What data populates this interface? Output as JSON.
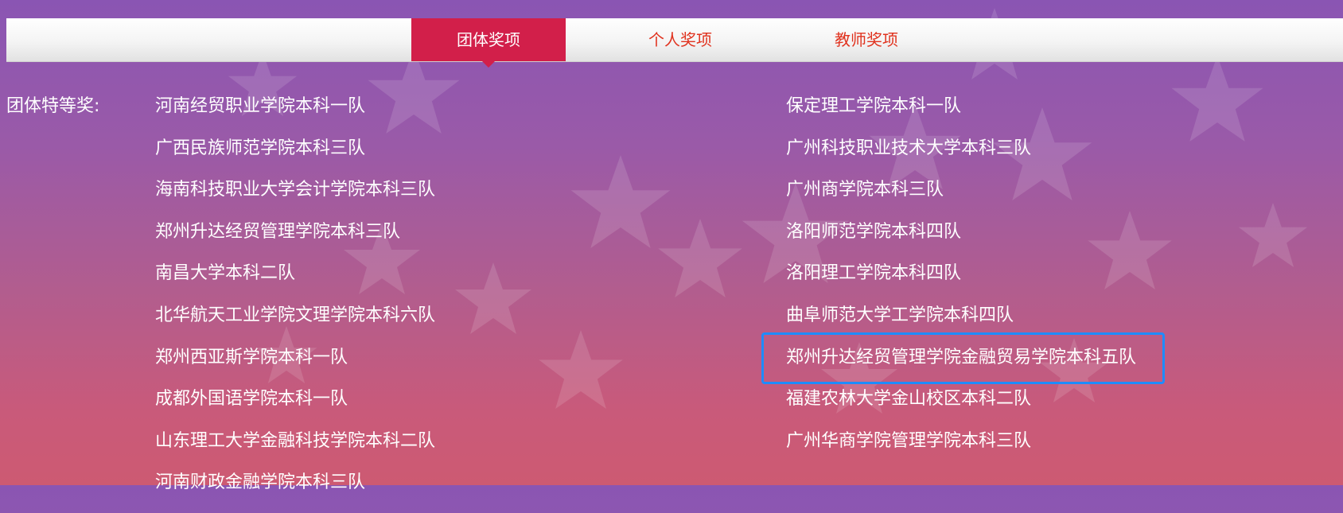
{
  "tabs": [
    {
      "label": "团体奖项",
      "active": true
    },
    {
      "label": "个人奖项",
      "active": false
    },
    {
      "label": "教师奖项",
      "active": false
    }
  ],
  "award_label": "团体特等奖:",
  "left_column": [
    "河南经贸职业学院本科一队",
    "广西民族师范学院本科三队",
    "海南科技职业大学会计学院本科三队",
    "郑州升达经贸管理学院本科三队",
    "南昌大学本科二队",
    "北华航天工业学院文理学院本科六队",
    "郑州西亚斯学院本科一队",
    "成都外国语学院本科一队",
    "山东理工大学金融科技学院本科二队",
    "河南财政金融学院本科三队"
  ],
  "right_column": [
    "保定理工学院本科一队",
    "广州科技职业技术大学本科三队",
    "广州商学院本科三队",
    "洛阳师范学院本科四队",
    "洛阳理工学院本科四队",
    "曲阜师范大学工学院本科四队",
    "郑州升达经贸管理学院金融贸易学院本科五队",
    "福建农林大学金山校区本科二队",
    "广州华商学院管理学院本科三队"
  ],
  "highlighted_item": "郑州升达经贸管理学院金融贸易学院本科五队",
  "colors": {
    "active_tab": "#d21f4a",
    "tab_text": "#e0321e",
    "highlight_border": "#1e8cff"
  }
}
